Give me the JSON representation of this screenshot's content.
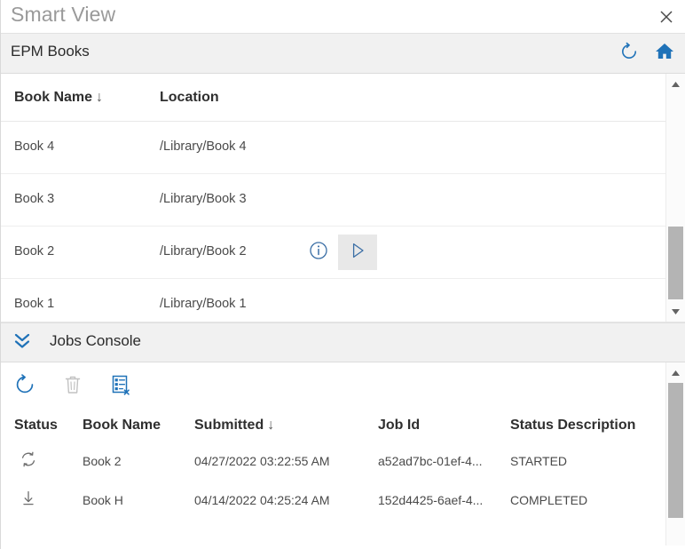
{
  "window": {
    "title": "Smart View",
    "close_icon": "close-icon"
  },
  "ribbon": {
    "title": "EPM Books",
    "refresh_icon": "refresh-icon",
    "home_icon": "home-icon"
  },
  "books": {
    "columns": [
      "Book Name",
      "Location"
    ],
    "sort_indicator": "↓",
    "rows": [
      {
        "name": "Book 4",
        "location": "/Library/Book 4",
        "actions": false
      },
      {
        "name": "Book 3",
        "location": "/Library/Book 3",
        "actions": false
      },
      {
        "name": "Book 2",
        "location": "/Library/Book 2",
        "actions": true
      },
      {
        "name": "Book 1",
        "location": "/Library/Book 1",
        "actions": false
      }
    ],
    "row_action_icons": [
      "info-icon",
      "play-icon"
    ],
    "scrollbar": {
      "up_icon": "triangle-up-icon",
      "down_icon": "triangle-down-icon"
    }
  },
  "jobs_console": {
    "title": "Jobs Console",
    "collapse_icon": "double-chevron-down-icon",
    "toolbar": [
      {
        "name": "refresh-jobs-icon",
        "enabled": true
      },
      {
        "name": "delete-job-icon",
        "enabled": false
      },
      {
        "name": "clear-job-list-icon",
        "enabled": true
      }
    ],
    "columns": [
      "Status",
      "Book Name",
      "Submitted",
      "Job Id",
      "Status Description"
    ],
    "sort_indicator": "↓",
    "rows": [
      {
        "status_icon": "in-progress-icon",
        "book_name": "Book 2",
        "submitted": "04/27/2022 03:22:55 AM",
        "job_id": "a52ad7bc-01ef-4...",
        "status_description": "STARTED"
      },
      {
        "status_icon": "download-icon",
        "book_name": "Book H",
        "submitted": "04/14/2022 04:25:24 AM",
        "job_id": "152d4425-6aef-4...",
        "status_description": "COMPLETED"
      }
    ],
    "scrollbar": {
      "up_icon": "triangle-up-icon"
    }
  },
  "colors": {
    "accent_blue": "#1f72b8",
    "ribbon_bg": "#f1f1f1",
    "title_text": "#9a9a9a",
    "scroll_thumb": "#b4b4b4"
  }
}
